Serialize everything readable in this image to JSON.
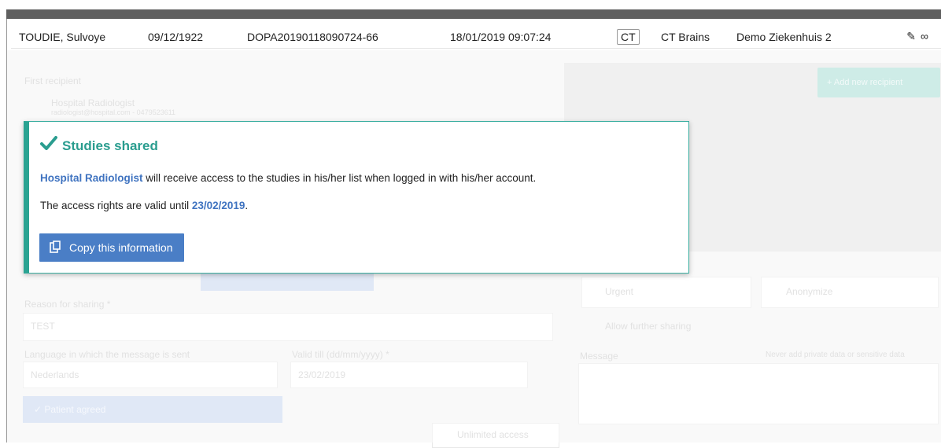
{
  "study_row": {
    "patient_name": "TOUDIE, Sulvoye",
    "birth_date": "09/12/1922",
    "accession": "DOPA20190118090724-66",
    "study_datetime": "18/01/2019 09:07:24",
    "modality": "CT",
    "description": "CT Brains",
    "institution": "Demo Ziekenhuis 2",
    "edit_icon": "pencil-icon",
    "link_icon": "infinity-icon"
  },
  "background": {
    "first_recipient_label": "First recipient",
    "recipient_name": "Hospital Radiologist",
    "recipient_email": "radiologist@hospital.com - 0479523611",
    "add_recipient_label": "+ Add new recipient",
    "reason_label": "Reason for sharing *",
    "reason_value": "TEST",
    "language_label": "Language in which the message is sent",
    "language_value": "Nederlands",
    "valid_label": "Valid till (dd/mm/yyyy) *",
    "valid_value": "23/02/2019",
    "urgent_label": "Urgent",
    "anonymize_label": "Anonymize",
    "allow_sharing_label": "Allow further sharing",
    "message_label": "Message",
    "message_hint": "Never add private data or sensitive data",
    "patient_agreed_label": "✓ Patient agreed",
    "unlimited_access_label": "Unlimited access"
  },
  "modal": {
    "title": "Studies shared",
    "check_icon": "checkmark-icon",
    "recipient": "Hospital Radiologist",
    "line1_rest": " will receive access to the studies in his/her list when logged in with his/her account.",
    "line2_prefix": "The access rights are valid until ",
    "valid_date": "23/02/2019",
    "line2_suffix": ".",
    "copy_button_label": "Copy this information",
    "copy_icon": "clipboard-icon"
  },
  "colors": {
    "accent_teal": "#2aa392",
    "button_blue": "#4a7ec6",
    "link_blue": "#3f73c0"
  }
}
